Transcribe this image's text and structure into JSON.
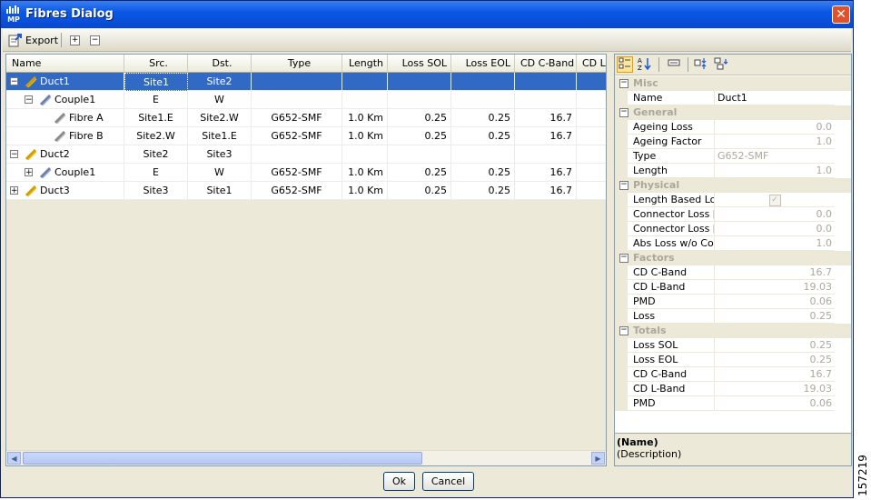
{
  "window": {
    "title": "Fibres Dialog",
    "app_icon_text": "MP",
    "close_glyph": "✕"
  },
  "toolbar": {
    "export_label": "Export",
    "expand_glyph": "+",
    "collapse_glyph": "−"
  },
  "grid": {
    "columns": [
      "Name",
      "Src.",
      "Dst.",
      "Type",
      "Length",
      "Loss SOL",
      "Loss EOL",
      "CD C-Band",
      "CD L-"
    ],
    "rows": [
      {
        "name": "Duct1",
        "src": "Site1",
        "dst": "Site2",
        "type": "",
        "length": "",
        "loss_sol": "",
        "loss_eol": "",
        "cd_c": "",
        "expander": "−",
        "level": 0,
        "icon": "duct-icon",
        "selected": true
      },
      {
        "name": "Couple1",
        "src": "E",
        "dst": "W",
        "type": "",
        "length": "",
        "loss_sol": "",
        "loss_eol": "",
        "cd_c": "",
        "expander": "−",
        "level": 1,
        "icon": "couple-icon"
      },
      {
        "name": "Fibre A",
        "src": "Site1.E",
        "dst": "Site2.W",
        "type": "G652-SMF",
        "length": "1.0 Km",
        "loss_sol": "0.25",
        "loss_eol": "0.25",
        "cd_c": "16.7",
        "expander": "",
        "level": 2,
        "icon": "fibre-icon"
      },
      {
        "name": "Fibre B",
        "src": "Site2.W",
        "dst": "Site1.E",
        "type": "G652-SMF",
        "length": "1.0 Km",
        "loss_sol": "0.25",
        "loss_eol": "0.25",
        "cd_c": "16.7",
        "expander": "",
        "level": 2,
        "icon": "fibre-icon"
      },
      {
        "name": "Duct2",
        "src": "Site2",
        "dst": "Site3",
        "type": "",
        "length": "",
        "loss_sol": "",
        "loss_eol": "",
        "cd_c": "",
        "expander": "−",
        "level": 0,
        "icon": "duct-icon"
      },
      {
        "name": "Couple1",
        "src": "E",
        "dst": "W",
        "type": "G652-SMF",
        "length": "1.0 Km",
        "loss_sol": "0.25",
        "loss_eol": "0.25",
        "cd_c": "16.7",
        "expander": "+",
        "level": 1,
        "icon": "couple-icon"
      },
      {
        "name": "Duct3",
        "src": "Site3",
        "dst": "Site1",
        "type": "G652-SMF",
        "length": "1.0 Km",
        "loss_sol": "0.25",
        "loss_eol": "0.25",
        "cd_c": "16.7",
        "expander": "+",
        "level": 0,
        "icon": "duct-icon"
      }
    ]
  },
  "properties": {
    "categories": [
      {
        "name": "Misc",
        "items": [
          {
            "k": "Name",
            "v": "Duct1",
            "style": "left"
          }
        ]
      },
      {
        "name": "General",
        "items": [
          {
            "k": "Ageing Loss",
            "v": "0.0"
          },
          {
            "k": "Ageing Factor",
            "v": "1.0"
          },
          {
            "k": "Type",
            "v": "G652-SMF",
            "style": "gl"
          },
          {
            "k": "Length",
            "v": "1.0"
          }
        ]
      },
      {
        "name": "Physical",
        "items": [
          {
            "k": "Length Based Loss",
            "v": "",
            "check": true
          },
          {
            "k": "Connector Loss [Sit...",
            "v": "0.0"
          },
          {
            "k": "Connector Loss [Sit...",
            "v": "0.0"
          },
          {
            "k": "Abs Loss w/o Conn...",
            "v": "1.0"
          }
        ]
      },
      {
        "name": "Factors",
        "items": [
          {
            "k": "CD C-Band",
            "v": "16.7"
          },
          {
            "k": "CD L-Band",
            "v": "19.03"
          },
          {
            "k": "PMD",
            "v": "0.06"
          },
          {
            "k": "Loss",
            "v": "0.25"
          }
        ]
      },
      {
        "name": "Totals",
        "items": [
          {
            "k": "Loss SOL",
            "v": "0.25"
          },
          {
            "k": "Loss EOL",
            "v": "0.25"
          },
          {
            "k": "CD C-Band",
            "v": "16.7"
          },
          {
            "k": "CD L-Band",
            "v": "19.03"
          },
          {
            "k": "PMD",
            "v": "0.06"
          }
        ]
      }
    ],
    "description_title": "(Name)",
    "description_text": "(Description)",
    "check_glyph": "✓",
    "collapse_glyph": "−"
  },
  "buttons": {
    "ok": "Ok",
    "cancel": "Cancel"
  },
  "watermark": "157219",
  "scroll": {
    "left": "◀",
    "right": "▶"
  },
  "colors": {
    "selection": "#316ac5",
    "title_bar": "#0a58e6",
    "close": "#e0502b"
  }
}
